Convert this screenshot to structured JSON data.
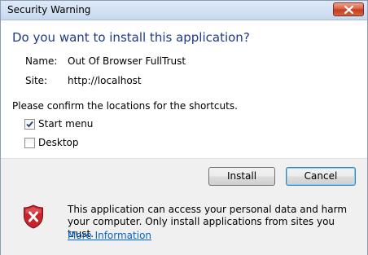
{
  "window": {
    "title": "Security Warning"
  },
  "dialog": {
    "heading": "Do you want to install this application?",
    "name_label": "Name:",
    "name_value": "Out Of Browser FullTrust",
    "site_label": "Site:",
    "site_value": "http://localhost",
    "confirm_text": "Please confirm the locations for the shortcuts.",
    "shortcuts": [
      {
        "label": "Start menu",
        "checked": true
      },
      {
        "label": "Desktop",
        "checked": false
      }
    ],
    "buttons": {
      "install": "Install",
      "cancel": "Cancel"
    },
    "warning_text": "This application can access your personal data and harm your computer. Only install applications from sites you trust.",
    "more_info_link": "More Information"
  },
  "icons": {
    "close": "close-icon",
    "shield": "security-shield-icon",
    "check": "checkmark-icon"
  },
  "colors": {
    "heading": "#1e3a8a",
    "link": "#0066cc",
    "shield_red": "#c8232c"
  }
}
